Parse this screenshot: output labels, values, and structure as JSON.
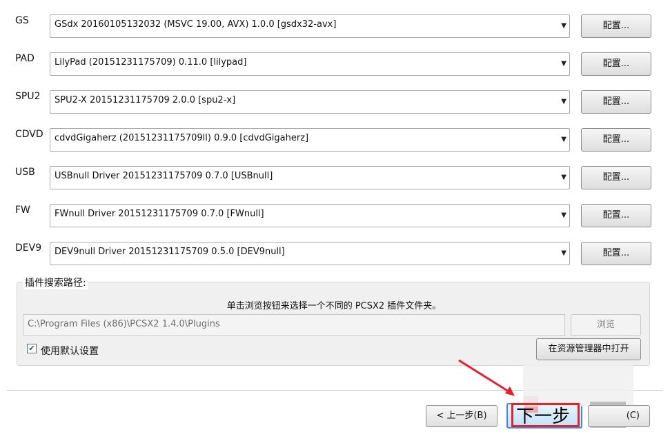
{
  "plugins": [
    {
      "label": "GS",
      "value": "GSdx 20160105132032 (MSVC 19.00, AVX) 1.0.0 [gsdx32-avx]",
      "config": "配置..."
    },
    {
      "label": "PAD",
      "value": "LilyPad (20151231175709) 0.11.0 [lilypad]",
      "config": "配置..."
    },
    {
      "label": "SPU2",
      "value": "SPU2-X 20151231175709 2.0.0 [spu2-x]",
      "config": "配置..."
    },
    {
      "label": "CDVD",
      "value": "cdvdGigaherz (20151231175709ll) 0.9.0 [cdvdGigaherz]",
      "config": "配置..."
    },
    {
      "label": "USB",
      "value": "USBnull Driver 20151231175709 0.7.0 [USBnull]",
      "config": "配置..."
    },
    {
      "label": "FW",
      "value": "FWnull Driver 20151231175709 0.7.0 [FWnull]",
      "config": "配置..."
    },
    {
      "label": "DEV9",
      "value": "DEV9null Driver 20151231175709 0.5.0 [DEV9null]",
      "config": "配置..."
    }
  ],
  "search_path": {
    "title": "插件搜索路径:",
    "hint": "单击浏览按钮来选择一个不同的 PCSX2 插件文件夹。",
    "path": "C:\\Program Files (x86)\\PCSX2 1.4.0\\Plugins",
    "browse": "浏览",
    "use_default": "使用默认设置",
    "use_default_checked": true,
    "open_explorer": "在资源管理器中打开"
  },
  "footer": {
    "back": "< 上一步(B)",
    "next": "下一步",
    "cancel": "(C)"
  },
  "colors": {
    "highlight": "#e8202a",
    "next_border": "#3a8de0"
  }
}
